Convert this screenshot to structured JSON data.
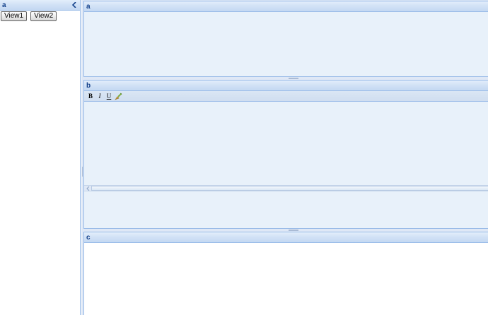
{
  "west": {
    "title": "a",
    "buttons": [
      {
        "label": "View1"
      },
      {
        "label": "View2"
      }
    ]
  },
  "center": {
    "panel_a": {
      "title": "a"
    },
    "panel_b": {
      "title": "b",
      "toolbar": [
        {
          "label": "B",
          "icon": "bold-icon"
        },
        {
          "label": "I",
          "icon": "italic-icon"
        },
        {
          "label": "U",
          "icon": "underline-icon"
        },
        {
          "label": "",
          "icon": "clear-format-brush-icon"
        }
      ]
    },
    "panel_c": {
      "title": "c"
    }
  },
  "colors": {
    "header_top": "#e3eefb",
    "header_bottom": "#c3d8f2",
    "border": "#99bbe8",
    "panel_bg": "#e8f1fa",
    "title_text": "#15428b"
  }
}
